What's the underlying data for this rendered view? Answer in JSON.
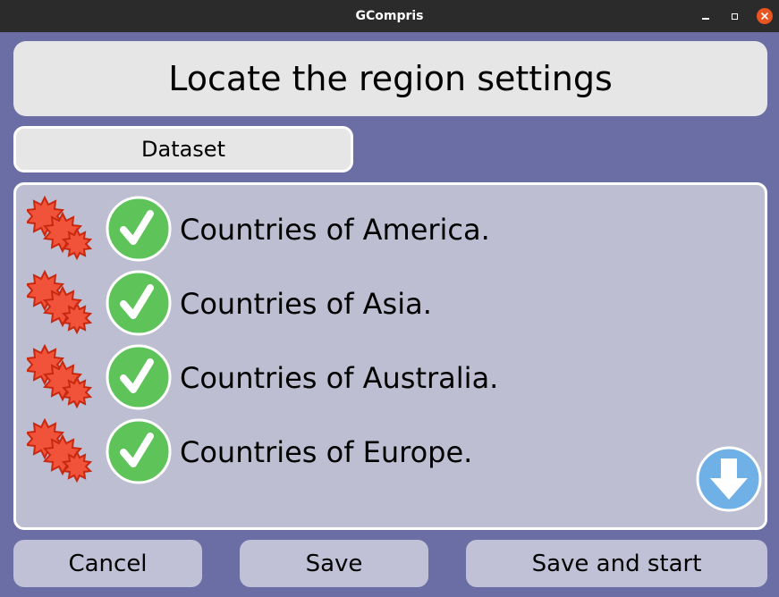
{
  "window": {
    "title": "GCompris"
  },
  "header": {
    "title": "Locate the region settings"
  },
  "tabs": [
    {
      "label": "Dataset"
    }
  ],
  "datasets": [
    {
      "label": "Countries of America.",
      "difficulty_icon": "difficulty-stars-icon",
      "selected": true
    },
    {
      "label": "Countries of Asia.",
      "difficulty_icon": "difficulty-stars-icon",
      "selected": true
    },
    {
      "label": "Countries of Australia.",
      "difficulty_icon": "difficulty-stars-icon",
      "selected": true
    },
    {
      "label": "Countries of Europe.",
      "difficulty_icon": "difficulty-stars-icon",
      "selected": true
    }
  ],
  "scroll": {
    "icon": "arrow-down-icon"
  },
  "footer": {
    "cancel_label": "Cancel",
    "save_label": "Save",
    "save_start_label": "Save and start"
  },
  "colors": {
    "background": "#6b6ea5",
    "panel": "#bebed2",
    "check_green": "#5ec45a",
    "star_red": "#f0533a",
    "scroll_blue": "#6fb0e6"
  }
}
